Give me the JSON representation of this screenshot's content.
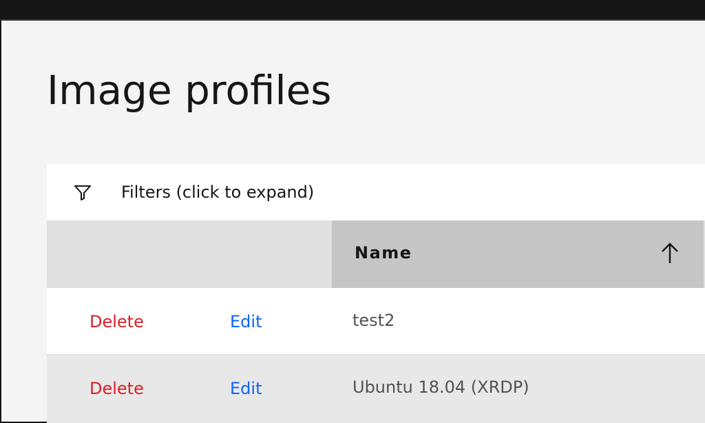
{
  "page": {
    "title": "Image profiles"
  },
  "filters": {
    "label": "Filters (click to expand)",
    "icon": "filter-icon"
  },
  "table": {
    "columns": [
      {
        "label": "",
        "key": "delete"
      },
      {
        "label": "",
        "key": "edit"
      },
      {
        "label": "Name",
        "key": "name",
        "sort": "ascending",
        "icon": "arrow-up-icon"
      }
    ],
    "rows": [
      {
        "delete": "Delete",
        "edit": "Edit",
        "name": "test2"
      },
      {
        "delete": "Delete",
        "edit": "Edit",
        "name": "Ubuntu 18.04 (XRDP)"
      }
    ]
  },
  "colors": {
    "delete": "#da1e28",
    "edit": "#0f62fe",
    "header_bg": "#e0e0e0",
    "sorted_header_bg": "#c6c6c6",
    "page_bg": "#f4f4f4"
  }
}
